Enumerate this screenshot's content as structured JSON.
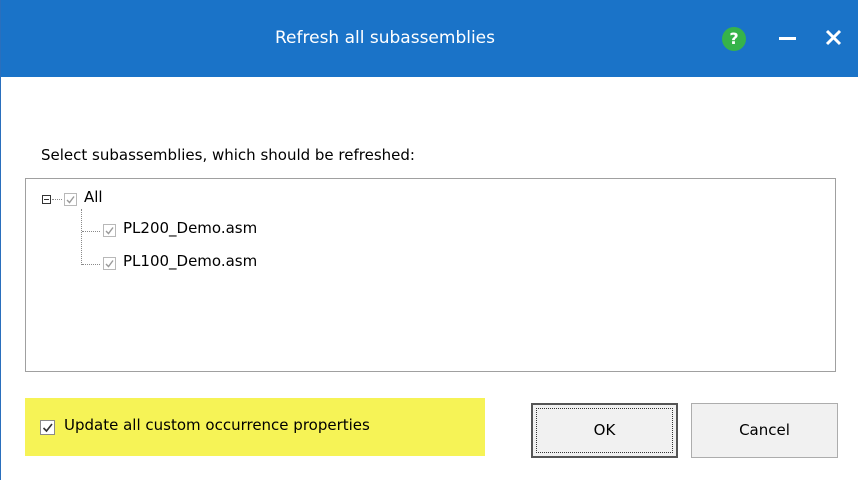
{
  "window": {
    "title": "Refresh all subassemblies",
    "help_label": "?",
    "accent": "#1a73c8"
  },
  "content": {
    "prompt": "Select subassemblies, which should be refreshed:",
    "tree": {
      "root": {
        "label": "All",
        "checked": true
      },
      "children": [
        {
          "label": "PL200_Demo.asm",
          "checked": true
        },
        {
          "label": "PL100_Demo.asm",
          "checked": true
        }
      ]
    },
    "option": {
      "label": "Update all custom occurrence properties",
      "checked": true,
      "highlight_color": "#f6f356"
    }
  },
  "buttons": {
    "ok_label": "OK",
    "cancel_label": "Cancel"
  }
}
